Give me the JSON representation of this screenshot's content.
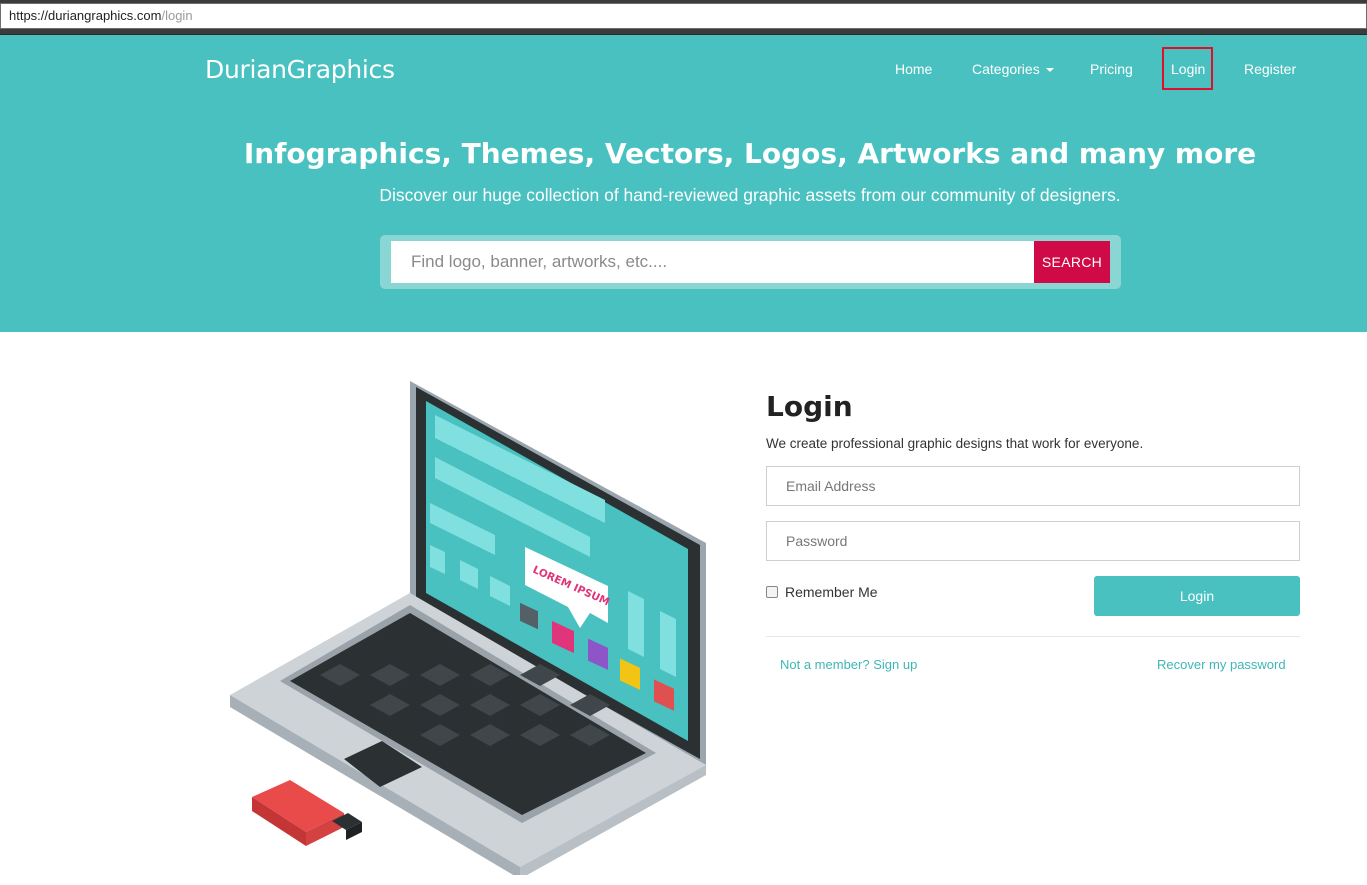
{
  "browser": {
    "url_host": "https://duriangraphics.com",
    "url_path": "/login"
  },
  "header": {
    "logo_text": "DurianGraphics",
    "nav": {
      "home": "Home",
      "categories": "Categories",
      "pricing": "Pricing",
      "login": "Login",
      "register": "Register"
    }
  },
  "hero": {
    "title": "Infographics, Themes, Vectors, Logos, Artworks and many more",
    "subtitle": "Discover our huge collection of hand-reviewed graphic assets from our community of designers.",
    "search_placeholder": "Find logo, banner, artworks, etc....",
    "search_button": "SEARCH"
  },
  "illustration": {
    "speech_bubble": "LOREM IPSUM"
  },
  "login_form": {
    "title": "Login",
    "description": "We create professional graphic designs that work for everyone.",
    "email_placeholder": "Email Address",
    "password_placeholder": "Password",
    "remember_label": "Remember Me",
    "submit_label": "Login",
    "signup_link": "Not a member? Sign up",
    "recover_link": "Recover my password"
  },
  "colors": {
    "brand_teal": "#48c1c0",
    "search_red": "#cf0a47",
    "highlight_red": "#e0102a"
  }
}
